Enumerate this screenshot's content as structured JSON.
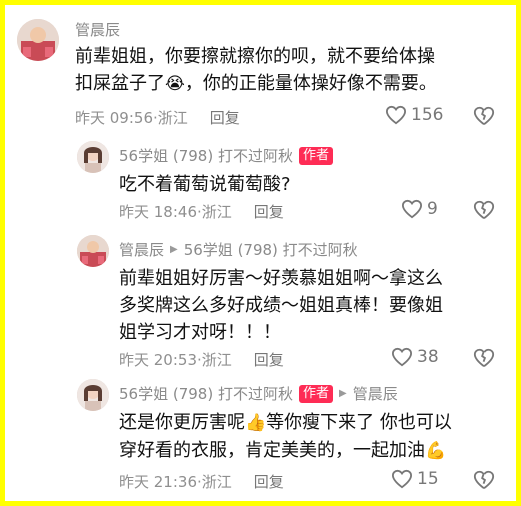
{
  "comments": [
    {
      "user": "管晨辰",
      "lines": [
        "前辈姐姐，你要擦就擦你的呗，就不要给体操",
        "扣屎盆子了",
        "，你的正能量体操好像不需要。"
      ],
      "emoji": "😭",
      "time": "昨天 09:56",
      "location": "浙江",
      "reply_label": "回复",
      "likes": "156"
    },
    {
      "user": "56学姐 (798) 打不过阿秋",
      "author_tag": "作者",
      "lines": [
        "吃不着葡萄说葡萄酸?"
      ],
      "time": "昨天 18:46",
      "location": "浙江",
      "reply_label": "回复",
      "likes": "9"
    },
    {
      "user": "管晨辰",
      "reply_to": "56学姐 (798) 打不过阿秋",
      "lines": [
        "前辈姐姐好厉害～好羡慕姐姐啊～拿这么",
        "多奖牌这么多好成绩～姐姐真棒！要像姐",
        "姐学习才对呀！！！"
      ],
      "time": "昨天 20:53",
      "location": "浙江",
      "reply_label": "回复",
      "likes": "38"
    },
    {
      "user": "56学姐 (798) 打不过阿秋",
      "author_tag": "作者",
      "reply_to": "管晨辰",
      "lines": [
        "还是你更厉害呢",
        "等你瘦下来了 你也可以",
        "穿好看的衣服，肯定美美的，一起加油"
      ],
      "emoji_thumb": "👍",
      "emoji_end": "💪",
      "time": "昨天 21:36",
      "location": "浙江",
      "reply_label": "回复",
      "likes": "15"
    }
  ],
  "icons": {
    "like": "heart-outline-icon",
    "dislike": "broken-heart-icon",
    "reply_arrow": "triangle-right-icon"
  },
  "colors": {
    "background_border": "#ffff00",
    "author_tag": "#fe2c55",
    "meta": "#8f8f8f"
  }
}
